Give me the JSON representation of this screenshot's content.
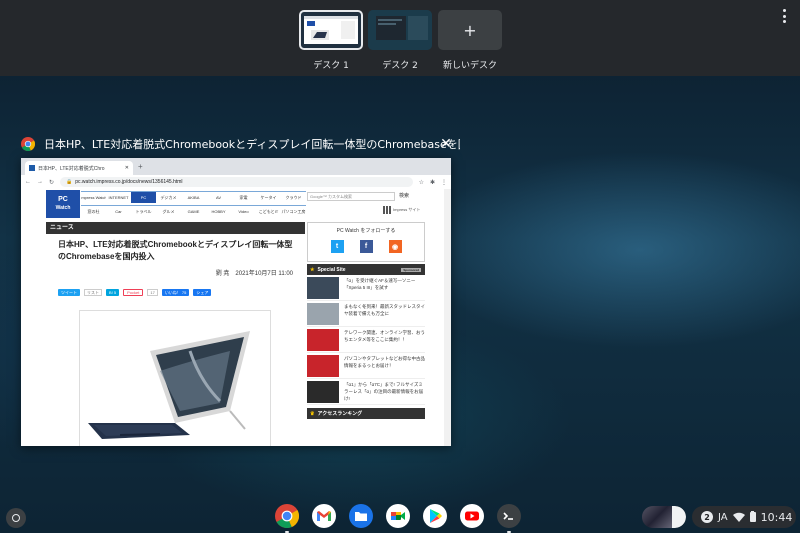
{
  "desks": [
    {
      "label": "デスク 1",
      "active": true
    },
    {
      "label": "デスク 2",
      "active": false
    },
    {
      "label": "新しいデスク",
      "icon": "+"
    }
  ],
  "window": {
    "title": "日本HP、LTE対応着脱式Chromebookとディスプレイ回転一体型のChromebaseを国...",
    "close_icon": "close-icon"
  },
  "browser": {
    "tab_title": "日本HP、LTE対応着脱式Chro",
    "tab_close": "✕",
    "new_tab": "+",
    "url": "pc.watch.impress.co.jp/docs/news/1356145.html",
    "site": {
      "logo_line1": "PC",
      "logo_line2": "Watch",
      "categories": [
        "Impress Watch",
        "INTERNET",
        "PC",
        "デジカメ",
        "AKIBA",
        "AV",
        "家電",
        "ケータイ",
        "クラウド",
        "窓の杜",
        "Car",
        "トラベル",
        "グルメ",
        "GAME",
        "HOBBY",
        "Video",
        "こどもとIT",
        "パソコン工房"
      ],
      "search_placeholder": "Google™ カスタム検索",
      "search_button": "検索",
      "impress_site": "Impress サイト"
    },
    "article": {
      "section": "ニュース",
      "title": "日本HP、LTE対応着脱式Chromebookとディスプレイ回転一体型のChromebaseを国内投入",
      "author_date": "劉 尭　2021年10月7日 11:00",
      "share": {
        "tweet": "ツイート",
        "tweet_count": "リスト",
        "hatena": "B! 5",
        "pocket": "Pocket",
        "pocket_count": "17",
        "like": "いいね！ 75",
        "share": "シェア"
      }
    },
    "sidebar": {
      "follow_title": "PC Watch をフォローする",
      "special_site": "Special Site",
      "special_tag": "Sponsored",
      "items": [
        {
          "text": "「α」を受け継ぐAF＆速写―ソニー「Xperia 5 III」を試す",
          "thumb_color": "#3b4a5a"
        },
        {
          "text": "まもなく冬到来！最新スタッドレスタイヤ装着で備えも万全に",
          "thumb_color": "#9aa4ad"
        },
        {
          "text": "テレワーク関連、オンライン学習、おうちエンタメ等をここに集約！！",
          "thumb_color": "#c8242b"
        },
        {
          "text": "パソコンやタブレットなどお得な中古品情報をまるっとお届け！",
          "thumb_color": "#c8242b"
        },
        {
          "text": "「α1」から「α7C」まで! フルサイズミラーレス「α」の注目の最新情報をお届け!",
          "thumb_color": "#2a2a2a"
        }
      ],
      "ranking": "アクセスランキング"
    }
  },
  "shelf": {
    "apps": [
      "chrome-icon",
      "gmail-icon",
      "files-icon",
      "meet-icon",
      "play-store-icon",
      "youtube-icon",
      "terminal-icon"
    ],
    "notification_count": "2",
    "ime": "JA",
    "time": "10:44"
  }
}
